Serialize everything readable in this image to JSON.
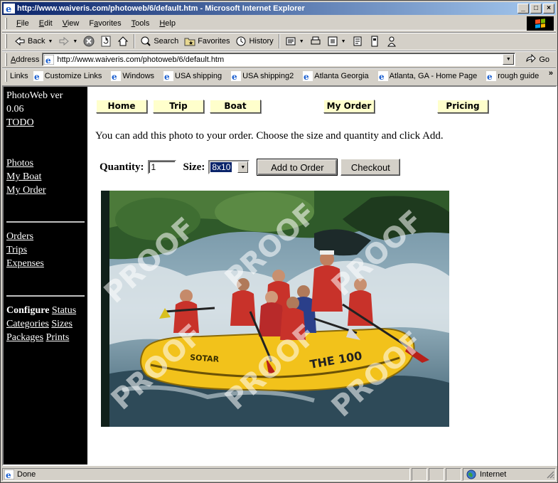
{
  "window": {
    "title": "http://www.waiveris.com/photoweb/6/default.htm - Microsoft Internet Explorer",
    "controls": {
      "minimize": "_",
      "maximize": "□",
      "close": "×"
    }
  },
  "menu": [
    {
      "label": "File",
      "key": "F"
    },
    {
      "label": "Edit",
      "key": "E"
    },
    {
      "label": "View",
      "key": "V"
    },
    {
      "label": "Favorites",
      "key": "a"
    },
    {
      "label": "Tools",
      "key": "T"
    },
    {
      "label": "Help",
      "key": "H"
    }
  ],
  "toolbar": {
    "back": "Back",
    "search": "Search",
    "favorites": "Favorites",
    "history": "History"
  },
  "address": {
    "label": "Address",
    "url": "http://www.waiveris.com/photoweb/6/default.htm",
    "go": "Go"
  },
  "links": {
    "label": "Links",
    "items": [
      "Customize Links",
      "Windows",
      "USA shipping",
      "USA shipping2",
      "Atlanta Georgia",
      "Atlanta, GA - Home Page",
      "rough guide"
    ],
    "more": "»"
  },
  "sidebar": {
    "app_name": "PhotoWeb ver",
    "version": "0.06",
    "todo": "TODO",
    "group1": [
      "Photos",
      "My Boat",
      "My Order"
    ],
    "group2": [
      "Orders",
      "Trips",
      "Expenses"
    ],
    "configure": "Configure",
    "config_links": [
      "Status",
      "Categories",
      "Sizes",
      "Packages",
      "Prints"
    ]
  },
  "nav": [
    "Home",
    "Trip",
    "Boat",
    "My Order",
    "Pricing"
  ],
  "main": {
    "intro": "You can add this photo to your order. Choose the size and quantity and click Add.",
    "quantity_label": "Quantity:",
    "quantity_value": "1",
    "size_label": "Size:",
    "size_value": "8x10",
    "add_button": "Add to Order",
    "checkout_button": "Checkout",
    "watermark": "PROOF"
  },
  "status": {
    "text": "Done",
    "zone": "Internet"
  }
}
